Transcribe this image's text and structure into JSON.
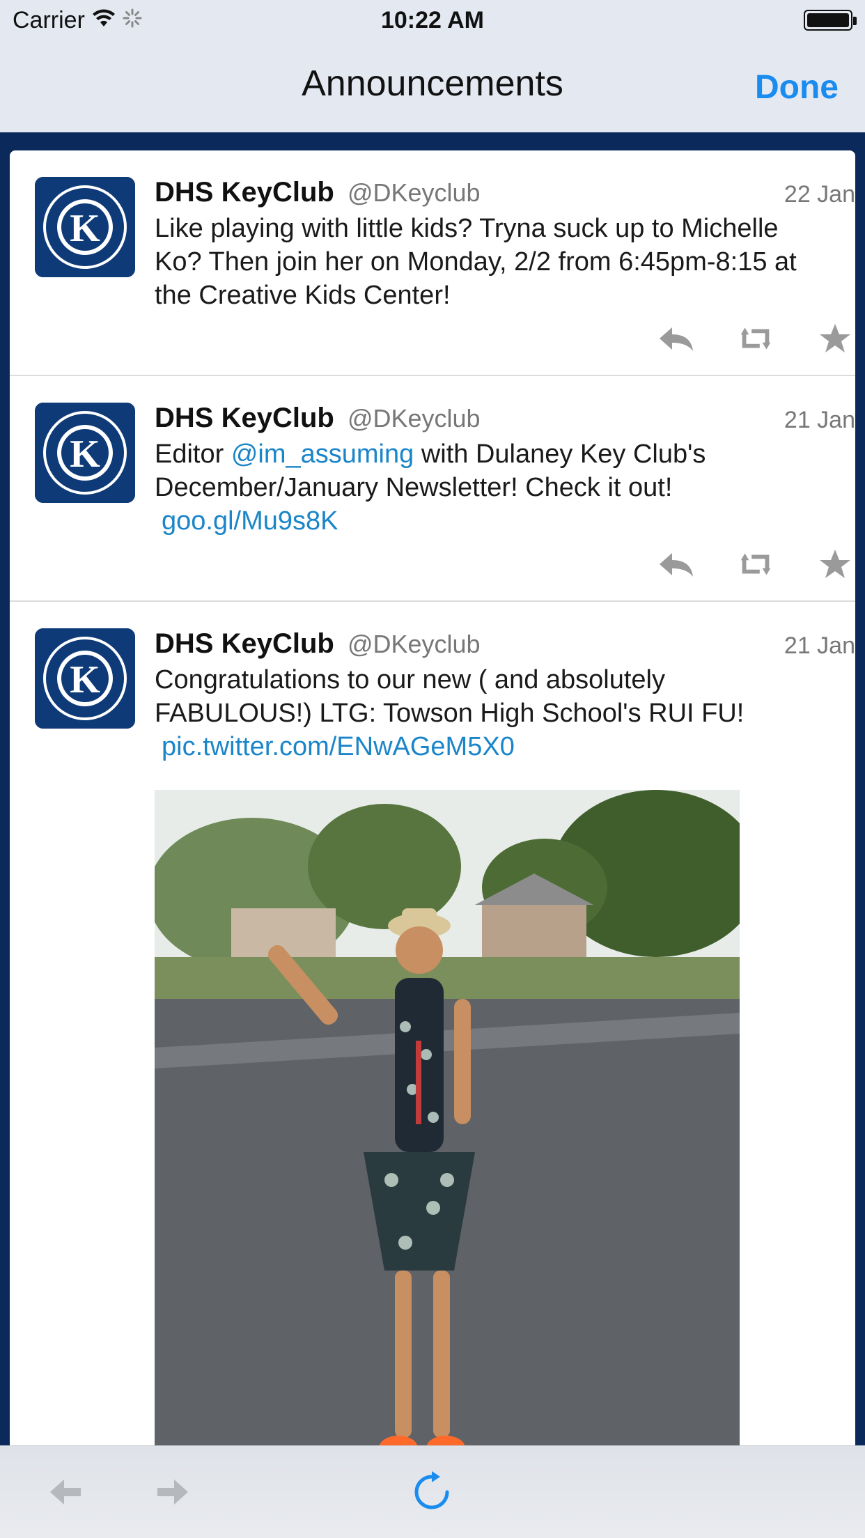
{
  "status_bar": {
    "carrier": "Carrier",
    "time": "10:22 AM"
  },
  "nav": {
    "title": "Announcements",
    "done_label": "Done"
  },
  "colors": {
    "accent": "#1a8cf0",
    "link": "#1b85c9",
    "nav_bg": "#e4e9f1",
    "frame": "#0b2a5b"
  },
  "tweets": [
    {
      "name": "DHS KeyClub",
      "handle": "@DKeyclub",
      "date": "22 Jan",
      "text_parts": [
        "Like playing with little kids? Tryna suck up to Michelle Ko? Then join her on Monday, 2/2 from 6:45pm-8:15 at the Creative Kids Center!"
      ]
    },
    {
      "name": "DHS KeyClub",
      "handle": "@DKeyclub",
      "date": "21 Jan",
      "text_parts": [
        "Editor ",
        "@im_assuming",
        " with Dulaney Key Club's December/January Newsletter! Check it out!",
        "goo.gl/Mu9s8K"
      ]
    },
    {
      "name": "DHS KeyClub",
      "handle": "@DKeyclub",
      "date": "21 Jan",
      "text_parts": [
        "Congratulations to our new ( and absolutely FABULOUS!) LTG: Towson High School's RUI FU!",
        "pic.twitter.com/ENwAGeM5X0"
      ]
    }
  ],
  "icons": {
    "reply": "reply-icon",
    "retweet": "retweet-icon",
    "favorite": "star-icon",
    "back": "back-arrow-icon",
    "forward": "forward-arrow-icon",
    "reload": "reload-icon"
  }
}
